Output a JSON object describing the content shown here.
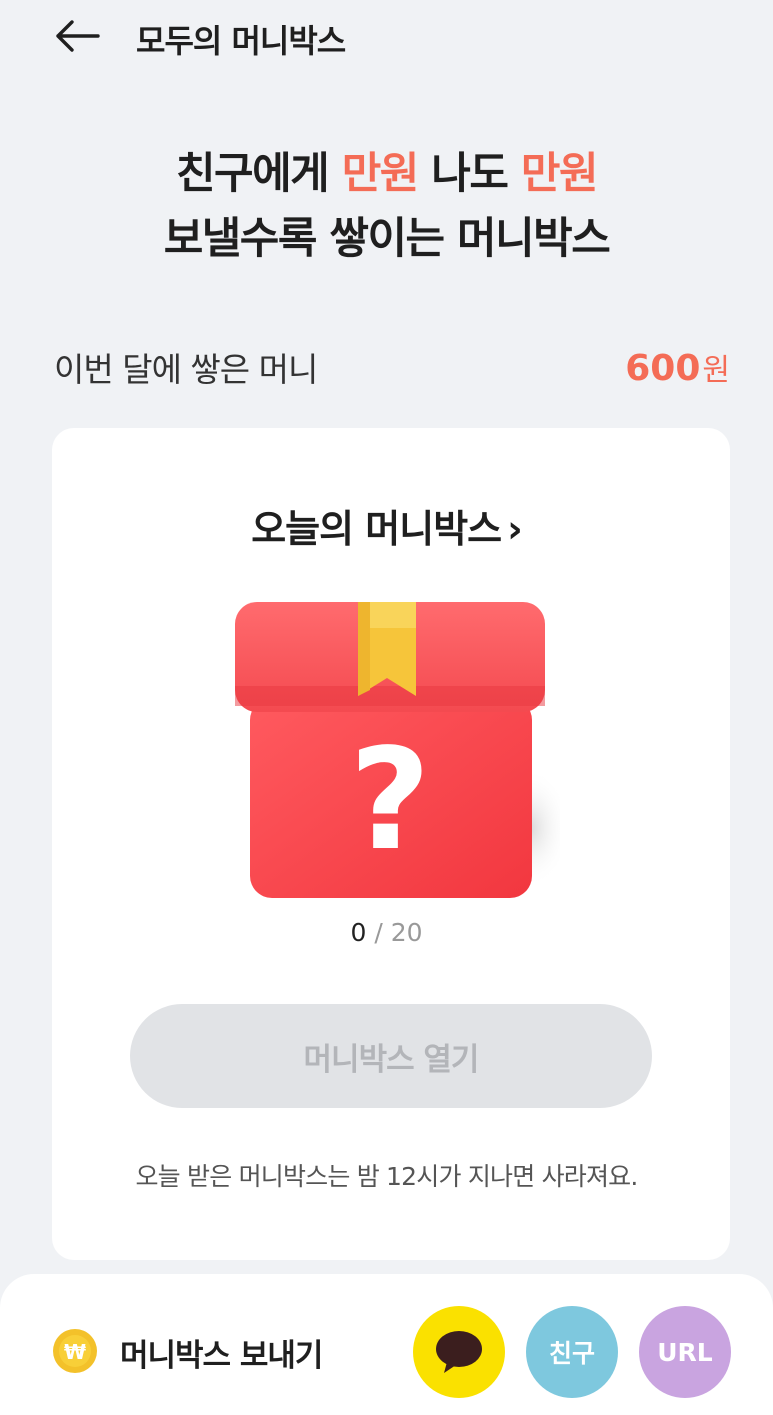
{
  "header": {
    "title": "모두의 머니박스",
    "back_icon": "arrow-left-icon"
  },
  "headline": {
    "line1_a": "친구에게 ",
    "line1_accent1": "만원",
    "line1_b": " 나도 ",
    "line1_accent2": "만원",
    "line2": "보낼수록 쌓이는 머니박스"
  },
  "monthly": {
    "label": "이번 달에 쌓은 머니",
    "amount": "600",
    "unit": "원"
  },
  "card": {
    "title": "오늘의 머니박스",
    "chevron": "›",
    "gift_icon": "mystery-gift-box-icon",
    "progress_current": "0",
    "progress_sep": "/",
    "progress_total": "20",
    "open_button": "머니박스 열기",
    "notice": "오늘 받은 머니박스는 밤 12시가 지나면 사라져요."
  },
  "bottom": {
    "coin_icon": "won-coin-icon",
    "label": "머니박스 보내기",
    "share_kakao_icon": "kakao-chat-icon",
    "share_friend": "친구",
    "share_url": "URL"
  },
  "colors": {
    "accent": "#f46c56",
    "kakao": "#fae100",
    "friend": "#7ec8de",
    "url": "#c9a4e0",
    "button_disabled": "#e1e3e6"
  }
}
